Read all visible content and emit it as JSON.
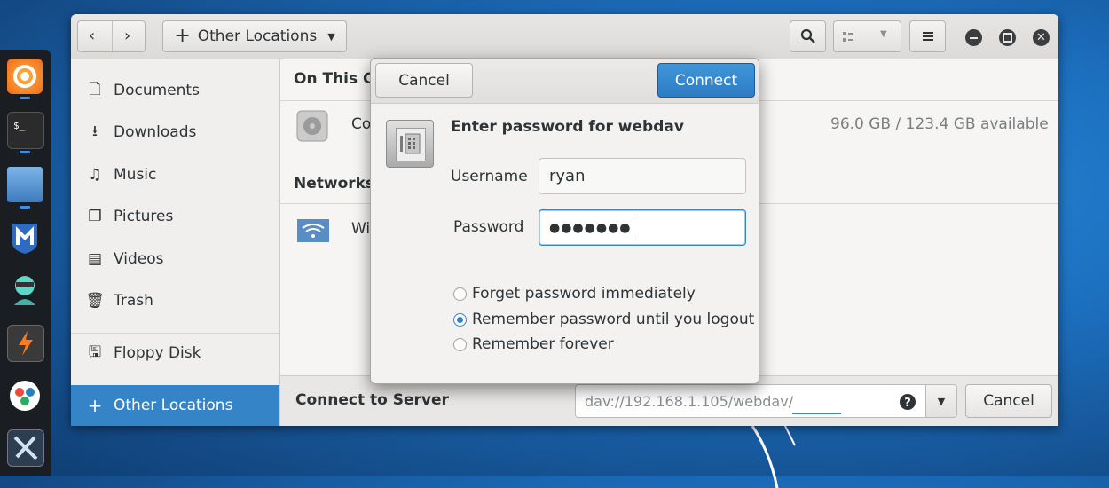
{
  "window": {
    "path_label": "Other Locations"
  },
  "sidebar": {
    "items": [
      {
        "label": "Documents",
        "icon": "document-icon"
      },
      {
        "label": "Downloads",
        "icon": "download-icon"
      },
      {
        "label": "Music",
        "icon": "music-icon"
      },
      {
        "label": "Pictures",
        "icon": "pictures-icon"
      },
      {
        "label": "Videos",
        "icon": "videos-icon"
      },
      {
        "label": "Trash",
        "icon": "trash-icon"
      },
      {
        "label": "Floppy Disk",
        "icon": "floppy-icon"
      },
      {
        "label": "Other Locations",
        "icon": "plus-icon"
      }
    ]
  },
  "main": {
    "this_computer_title": "On This Co",
    "computer_label": "Co",
    "computer_space": "96.0 GB / 123.4 GB available",
    "computer_mount": "/",
    "networks_title": "Networks",
    "network_label": "Wi"
  },
  "bottombar": {
    "title": "Connect to Server",
    "server_url": "dav://192.168.1.105/webdav/",
    "cancel_label": "Cancel"
  },
  "dialog": {
    "cancel_label": "Cancel",
    "connect_label": "Connect",
    "prompt": "Enter password for webdav",
    "username_label": "Username",
    "username_value": "ryan",
    "password_label": "Password",
    "password_mask": "●●●●●●●",
    "options": [
      {
        "label": "Forget password immediately",
        "selected": false
      },
      {
        "label": "Remember password until you logout",
        "selected": true
      },
      {
        "label": "Remember forever",
        "selected": false
      }
    ]
  },
  "colors": {
    "accent": "#3584c8",
    "desktop": "#1c6fbf"
  }
}
